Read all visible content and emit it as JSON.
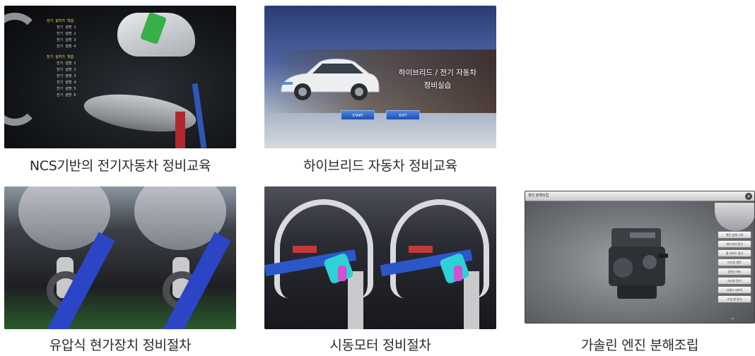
{
  "tiles": [
    {
      "caption": "NCS기반의 전기자동차 정비교육",
      "menu": {
        "header_1": "전기 설치가 학습",
        "items_1": [
          "전기 설명 1",
          "전기 설명 2",
          "전기 설명 3",
          "전기 설명 4"
        ],
        "header_2": "전기 설치가 학습",
        "items_2": [
          "전기 설명 1",
          "전기 설명 2",
          "전기 설명 3",
          "전기 설명 4",
          "전기 설명 5",
          "전기 설명 6"
        ]
      }
    },
    {
      "caption": "하이브리드 자동차 정비교육",
      "screen_title_line1": "하이브리드 / 전기 자동차",
      "screen_title_line2": "정비실습",
      "start_label": "START",
      "exit_label": "EXIT"
    },
    {
      "caption": "유압식 현가장치 정비절차"
    },
    {
      "caption": "시동모터 정비절차"
    },
    {
      "caption": "가솔린 엔진 분해조립",
      "window_title": "엔진 분해조립",
      "close_glyph": "×",
      "panel_buttons": [
        "엔진 분해 시작",
        "헤드커버 탈거",
        "캠 샤프트 탈거",
        "타이밍 벨트",
        "실린더 헤드",
        "피스톤 탈거",
        "크랭크 샤프트",
        "오일 팬 탈거"
      ],
      "arrow_glyph": "⌄"
    }
  ],
  "colors": {
    "accent_blue": "#2b57c8",
    "menu_yellow": "#f2e35a",
    "button_blue": "#1d4fb0"
  }
}
